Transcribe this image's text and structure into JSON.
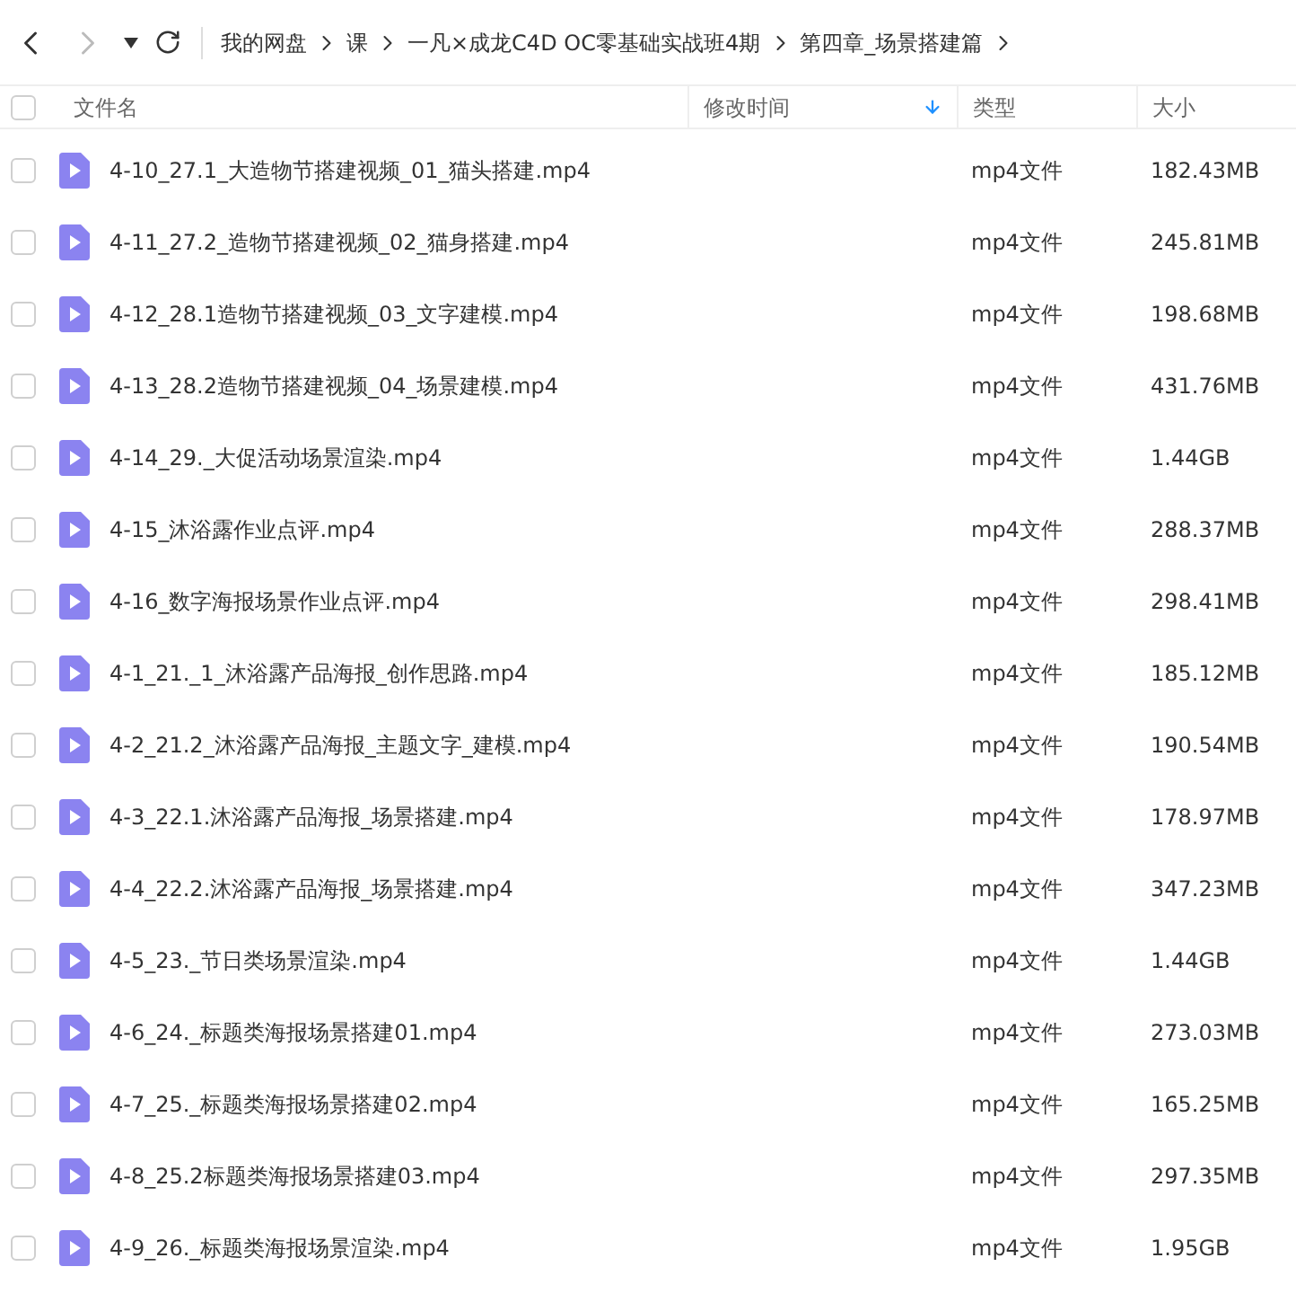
{
  "nav": {
    "back_disabled": false,
    "forward_disabled": true
  },
  "breadcrumbs": [
    "我的网盘",
    "课",
    "一凡×成龙C4D OC零基础实战班4期",
    "第四章_场景搭建篇"
  ],
  "table": {
    "select_all_checked": false,
    "columns": [
      {
        "label": "文件名",
        "sorted": false
      },
      {
        "label": "修改时间",
        "sorted": true
      },
      {
        "label": "类型",
        "sorted": false
      },
      {
        "label": "大小",
        "sorted": false
      }
    ],
    "rows": [
      {
        "name": "4-10_27.1_大造物节搭建视频_01_猫头搭建.mp4",
        "type": "mp4文件",
        "size": "182.43MB",
        "checked": false
      },
      {
        "name": "4-11_27.2_造物节搭建视频_02_猫身搭建.mp4",
        "type": "mp4文件",
        "size": "245.81MB",
        "checked": false
      },
      {
        "name": "4-12_28.1造物节搭建视频_03_文字建模.mp4",
        "type": "mp4文件",
        "size": "198.68MB",
        "checked": false
      },
      {
        "name": "4-13_28.2造物节搭建视频_04_场景建模.mp4",
        "type": "mp4文件",
        "size": "431.76MB",
        "checked": false
      },
      {
        "name": "4-14_29._大促活动场景渲染.mp4",
        "type": "mp4文件",
        "size": "1.44GB",
        "checked": false
      },
      {
        "name": "4-15_沐浴露作业点评.mp4",
        "type": "mp4文件",
        "size": "288.37MB",
        "checked": false
      },
      {
        "name": "4-16_数字海报场景作业点评.mp4",
        "type": "mp4文件",
        "size": "298.41MB",
        "checked": false
      },
      {
        "name": "4-1_21._1_沐浴露产品海报_创作思路.mp4",
        "type": "mp4文件",
        "size": "185.12MB",
        "checked": false
      },
      {
        "name": "4-2_21.2_沐浴露产品海报_主题文字_建模.mp4",
        "type": "mp4文件",
        "size": "190.54MB",
        "checked": false
      },
      {
        "name": "4-3_22.1.沐浴露产品海报_场景搭建.mp4",
        "type": "mp4文件",
        "size": "178.97MB",
        "checked": false
      },
      {
        "name": "4-4_22.2.沐浴露产品海报_场景搭建.mp4",
        "type": "mp4文件",
        "size": "347.23MB",
        "checked": false
      },
      {
        "name": "4-5_23._节日类场景渲染.mp4",
        "type": "mp4文件",
        "size": "1.44GB",
        "checked": false
      },
      {
        "name": "4-6_24._标题类海报场景搭建01.mp4",
        "type": "mp4文件",
        "size": "273.03MB",
        "checked": false
      },
      {
        "name": "4-7_25._标题类海报场景搭建02.mp4",
        "type": "mp4文件",
        "size": "165.25MB",
        "checked": false
      },
      {
        "name": "4-8_25.2标题类海报场景搭建03.mp4",
        "type": "mp4文件",
        "size": "297.35MB",
        "checked": false
      },
      {
        "name": "4-9_26._标题类海报场景渲染.mp4",
        "type": "mp4文件",
        "size": "1.95GB",
        "checked": false
      }
    ]
  }
}
